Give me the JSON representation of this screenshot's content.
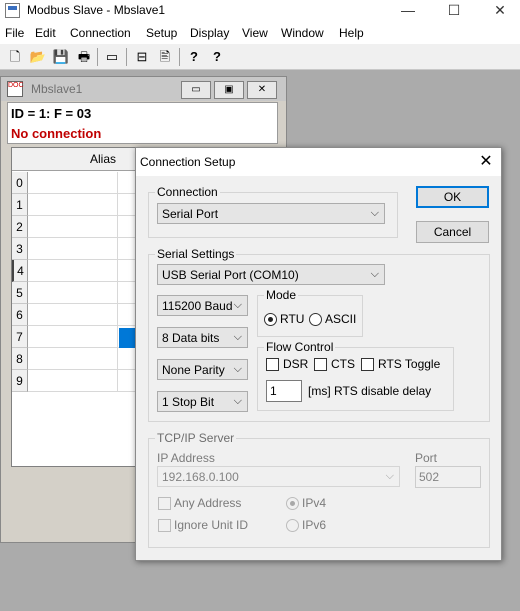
{
  "window": {
    "title": "Modbus Slave - Mbslave1",
    "minimize_glyph": "—",
    "maximize_glyph": "☐",
    "close_glyph": "✕"
  },
  "menu": [
    "File",
    "Edit",
    "Connection",
    "Setup",
    "Display",
    "View",
    "Window",
    "Help"
  ],
  "toolbar": {
    "icons": [
      "new-document-icon",
      "open-folder-icon",
      "save-icon",
      "print-icon",
      "window-icon",
      "disconnected-icon",
      "print-preview-icon",
      "help-icon",
      "context-help-icon"
    ],
    "glyphs": [
      "🗋",
      "📂",
      "💾",
      "🖶",
      "▭",
      "⊟",
      "🖹",
      "?",
      "?"
    ]
  },
  "child": {
    "title": "Mbslave1",
    "icon_text": "DOC",
    "minimize_glyph": "▭",
    "restore_glyph": "▣",
    "close_glyph": "✕",
    "id_line": "ID = 1: F = 03",
    "status": "No connection",
    "status_color": "#c00000",
    "alias_header": "Alias",
    "rows": [
      "0",
      "1",
      "2",
      "3",
      "4",
      "5",
      "6",
      "7",
      "8",
      "9"
    ],
    "selected_row": "4"
  },
  "dialog": {
    "title": "Connection Setup",
    "close_glyph": "✕",
    "ok": "OK",
    "cancel": "Cancel",
    "connection": {
      "label": "Connection",
      "value": "Serial Port"
    },
    "serial": {
      "label": "Serial Settings",
      "port": "USB Serial Port (COM10)",
      "baud": "115200 Baud",
      "data_bits": "8 Data bits",
      "parity": "None Parity",
      "stop_bits": "1 Stop Bit"
    },
    "mode": {
      "label": "Mode",
      "rtu": "RTU",
      "ascii": "ASCII",
      "selected": "RTU"
    },
    "flow": {
      "label": "Flow Control",
      "dsr": "DSR",
      "cts": "CTS",
      "rts_toggle": "RTS Toggle",
      "delay_value": "1",
      "delay_label": "[ms] RTS disable delay"
    },
    "tcp": {
      "label": "TCP/IP Server",
      "ip_label": "IP Address",
      "ip_value": "192.168.0.100",
      "port_label": "Port",
      "port_value": "502",
      "any_address": "Any Address",
      "ignore_unit_id": "Ignore Unit ID",
      "ipv4": "IPv4",
      "ipv6": "IPv6",
      "selected_ip_version": "IPv4"
    }
  },
  "colors": {
    "desktop": "#ababab",
    "selection": "#0078d7",
    "default_button_border": "#0078d7"
  }
}
